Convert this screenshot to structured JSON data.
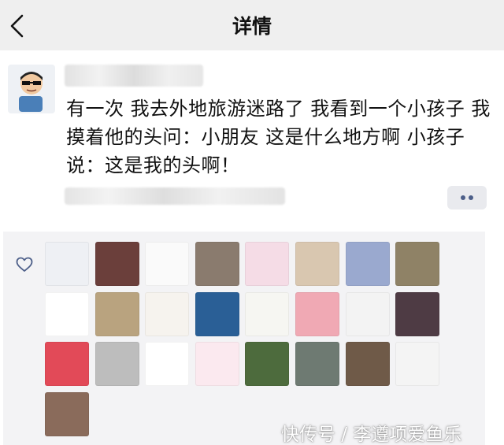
{
  "header": {
    "title": "详情",
    "back_icon": "chevron-left-icon"
  },
  "post": {
    "text": "有一次 我去外地旅游迷路了 我看到一个小孩子 我摸着他的头问：小朋友 这是什么地方啊 小孩子说：这是我的头啊！",
    "more_icon": "more-dots-icon"
  },
  "likes": {
    "icon": "heart-icon",
    "avatars": [
      {
        "name": "avatar-1",
        "bg": "#eef0f4"
      },
      {
        "name": "avatar-2",
        "bg": "#6b3f3b"
      },
      {
        "name": "avatar-3",
        "bg": "#fafafa"
      },
      {
        "name": "avatar-4",
        "bg": "#8a7b6e"
      },
      {
        "name": "avatar-5",
        "bg": "#f5dce6"
      },
      {
        "name": "avatar-6",
        "bg": "#d9c7b0"
      },
      {
        "name": "avatar-7",
        "bg": "#9aa9cf"
      },
      {
        "name": "avatar-8",
        "bg": "#8f8266"
      },
      {
        "name": "avatar-9",
        "bg": "#ffffff"
      },
      {
        "name": "avatar-10",
        "bg": "#b9a37f"
      },
      {
        "name": "avatar-11",
        "bg": "#f6f3ee"
      },
      {
        "name": "avatar-12",
        "bg": "#2a5f96"
      },
      {
        "name": "avatar-13",
        "bg": "#f6f6f2"
      },
      {
        "name": "avatar-14",
        "bg": "#f0a9b4"
      },
      {
        "name": "avatar-15",
        "bg": "#f3f3f3"
      },
      {
        "name": "avatar-16",
        "bg": "#4e3b44"
      },
      {
        "name": "avatar-17",
        "bg": "#e24a58"
      },
      {
        "name": "avatar-18",
        "bg": "#bdbdbd"
      },
      {
        "name": "avatar-19",
        "bg": "#ffffff"
      },
      {
        "name": "avatar-20",
        "bg": "#fbe9ef"
      },
      {
        "name": "avatar-21",
        "bg": "#4d6b3d"
      },
      {
        "name": "avatar-22",
        "bg": "#6e7a72"
      },
      {
        "name": "avatar-23",
        "bg": "#6f5a48"
      },
      {
        "name": "avatar-24",
        "bg": "#f4f4f4"
      },
      {
        "name": "avatar-25",
        "bg": "#8a6b5b"
      }
    ]
  },
  "watermark": "快传号 / 李遵项爱鱼乐"
}
